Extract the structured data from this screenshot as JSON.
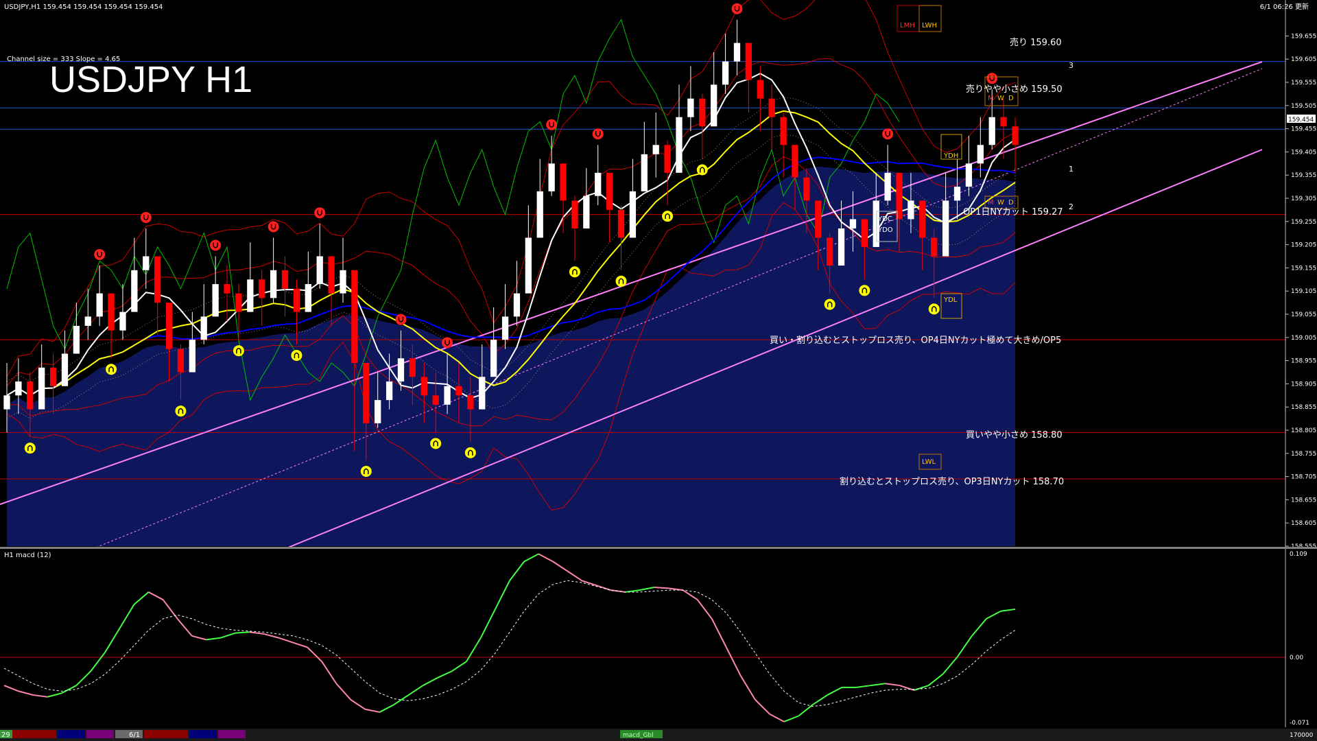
{
  "header": {
    "symbol_info": "USDJPY,H1  159.454 159.454 159.454 159.454",
    "channel_info": "Channel size = 333 Slope = 4.65",
    "big_title": "USDJPY H1",
    "datetime": "6/1 06:26 更新"
  },
  "price_tag": "159.454",
  "channel_labels": [
    "1",
    "2",
    "3"
  ],
  "box_labels": {
    "lmh": "LMH",
    "lwh": "LWH",
    "m": "M",
    "w": "W",
    "d": "D",
    "ydh": "YDH",
    "ydl": "YDL",
    "ydc": "YDC",
    "ydo": "YDO",
    "lwl": "LWL"
  },
  "level_labels": {
    "sell_1": "売り 159.60",
    "sell_2": "売りやや小さめ 159.50",
    "op1": "OP1日NYカット 159.27",
    "buy_1": "買い・割り込むとストップロス売り、OP4日NYカット極めて大きめ/OP5",
    "buy_2": "買いやや小さめ 158.80",
    "buy_3": "割り込むとストップロス売り、OP3日NYカット 158.70"
  },
  "sub_panel": {
    "label": "H1  macd (12)",
    "tab": "macd_Gbl"
  },
  "bottom_bar": {
    "left_date": "29",
    "mid_date": "6/1",
    "volume": "170000"
  },
  "colors": {
    "up": "#ffffff",
    "down": "#ff0000",
    "ma_short": "#ffffff",
    "ma_mid": "#ffff00",
    "ma_long": "#0000ff",
    "kumo_up": "#1a2aa8",
    "kumo_down": "#c8a080",
    "chikou": "#00c000",
    "bollinger": "#cc0000",
    "channel": "#ff80ff",
    "macd_up": "#44ff44",
    "macd_down": "#ff88aa"
  },
  "chart_data": {
    "type": "candlestick",
    "title": "USDJPY H1",
    "ylim": [
      158.555,
      159.7
    ],
    "yticks": [
      159.655,
      159.605,
      159.555,
      159.505,
      159.455,
      159.405,
      159.355,
      159.305,
      159.255,
      159.205,
      159.155,
      159.105,
      159.055,
      159.005,
      158.955,
      158.905,
      158.855,
      158.805,
      158.755,
      158.705,
      158.655,
      158.605,
      158.555
    ],
    "ytick_labels": [
      "159.655",
      "159.605",
      "159.555",
      "159.505",
      "159.455",
      "159.405",
      "159.355",
      "159.305",
      "159.255",
      "159.205",
      "159.155",
      "159.105",
      "159.055",
      "159.005",
      "158.955",
      "158.905",
      "158.855",
      "158.805",
      "158.755",
      "158.705",
      "158.655",
      "158.605",
      "158.555"
    ],
    "last_price": 159.454,
    "levels": [
      159.6,
      159.5,
      159.27,
      159.0,
      158.8,
      158.7
    ],
    "close": [
      158.88,
      158.91,
      158.85,
      158.94,
      158.9,
      158.97,
      159.03,
      159.05,
      159.1,
      159.02,
      159.06,
      159.15,
      159.18,
      159.08,
      158.98,
      158.93,
      159.0,
      159.05,
      159.12,
      159.1,
      159.06,
      159.13,
      159.09,
      159.15,
      159.11,
      159.06,
      159.12,
      159.18,
      159.1,
      159.15,
      158.95,
      158.82,
      158.87,
      158.91,
      158.96,
      158.92,
      158.88,
      158.86,
      158.9,
      158.88,
      158.85,
      158.92,
      159.0,
      159.05,
      159.1,
      159.22,
      159.32,
      159.38,
      159.3,
      159.24,
      159.31,
      159.36,
      159.28,
      159.22,
      159.32,
      159.4,
      159.42,
      159.36,
      159.48,
      159.52,
      159.46,
      159.55,
      159.6,
      159.64,
      159.56,
      159.52,
      159.48,
      159.42,
      159.35,
      159.3,
      159.22,
      159.16,
      159.24,
      159.26,
      159.2,
      159.3,
      159.36,
      159.26,
      159.3,
      159.22,
      159.18,
      159.3,
      159.33,
      159.38,
      159.42,
      159.48,
      159.46,
      159.42
    ],
    "high": [
      158.95,
      158.96,
      158.93,
      158.99,
      158.97,
      159.02,
      159.08,
      159.11,
      159.16,
      159.09,
      159.12,
      159.22,
      159.24,
      159.16,
      159.05,
      158.99,
      159.06,
      159.12,
      159.18,
      159.16,
      159.12,
      159.21,
      159.15,
      159.22,
      159.18,
      159.13,
      159.19,
      159.25,
      159.17,
      159.22,
      159.05,
      158.9,
      158.93,
      158.97,
      159.02,
      158.99,
      158.95,
      158.93,
      158.97,
      158.95,
      158.92,
      158.99,
      159.07,
      159.12,
      159.17,
      159.29,
      159.39,
      159.44,
      159.38,
      159.31,
      159.37,
      159.42,
      159.35,
      159.29,
      159.39,
      159.47,
      159.49,
      159.43,
      159.55,
      159.59,
      159.53,
      159.62,
      159.66,
      159.69,
      159.62,
      159.59,
      159.55,
      159.49,
      159.42,
      159.37,
      159.29,
      159.23,
      159.3,
      159.32,
      159.26,
      159.36,
      159.42,
      159.33,
      159.36,
      159.29,
      159.24,
      159.36,
      159.39,
      159.44,
      159.48,
      159.54,
      159.52,
      159.48
    ],
    "low": [
      158.8,
      158.84,
      158.79,
      158.87,
      158.84,
      158.91,
      158.97,
      159.0,
      159.03,
      158.96,
      159.0,
      159.07,
      159.11,
      159.01,
      158.91,
      158.87,
      158.94,
      158.99,
      159.05,
      159.04,
      159.0,
      159.06,
      159.03,
      159.08,
      159.05,
      158.99,
      159.06,
      159.11,
      159.03,
      159.08,
      158.76,
      158.74,
      158.81,
      158.85,
      158.89,
      158.86,
      158.82,
      158.8,
      158.84,
      158.82,
      158.78,
      158.85,
      158.93,
      158.98,
      159.03,
      159.14,
      159.25,
      159.31,
      159.23,
      159.17,
      159.24,
      159.29,
      159.21,
      159.15,
      159.25,
      159.33,
      159.35,
      159.29,
      159.41,
      159.45,
      159.39,
      159.48,
      159.53,
      159.57,
      159.49,
      159.45,
      159.41,
      159.35,
      159.28,
      159.23,
      159.15,
      159.1,
      159.17,
      159.19,
      159.13,
      159.23,
      159.29,
      159.19,
      159.23,
      159.15,
      159.09,
      159.23,
      159.26,
      159.31,
      159.35,
      159.41,
      159.39,
      159.36
    ],
    "macd": {
      "ylim": [
        -0.071,
        0.109
      ],
      "ytick_labels": [
        "0.109",
        "0.00",
        "-0.071"
      ],
      "values": [
        -0.03,
        -0.036,
        -0.04,
        -0.042,
        -0.038,
        -0.03,
        -0.015,
        0.005,
        0.03,
        0.055,
        0.068,
        0.06,
        0.04,
        0.022,
        0.018,
        0.02,
        0.025,
        0.026,
        0.024,
        0.02,
        0.015,
        0.01,
        -0.005,
        -0.028,
        -0.045,
        -0.055,
        -0.058,
        -0.05,
        -0.04,
        -0.03,
        -0.022,
        -0.015,
        -0.005,
        0.02,
        0.05,
        0.08,
        0.1,
        0.108,
        0.1,
        0.09,
        0.08,
        0.075,
        0.07,
        0.068,
        0.07,
        0.073,
        0.072,
        0.07,
        0.06,
        0.04,
        0.01,
        -0.02,
        -0.045,
        -0.06,
        -0.068,
        -0.062,
        -0.05,
        -0.04,
        -0.032,
        -0.032,
        -0.03,
        -0.028,
        -0.03,
        -0.035,
        -0.03,
        -0.018,
        0.0,
        0.022,
        0.04,
        0.048,
        0.05
      ],
      "signal": [
        -0.012,
        -0.02,
        -0.028,
        -0.034,
        -0.036,
        -0.034,
        -0.028,
        -0.018,
        -0.004,
        0.012,
        0.028,
        0.04,
        0.044,
        0.04,
        0.034,
        0.03,
        0.028,
        0.027,
        0.026,
        0.024,
        0.022,
        0.018,
        0.012,
        0.002,
        -0.012,
        -0.026,
        -0.038,
        -0.044,
        -0.046,
        -0.044,
        -0.04,
        -0.034,
        -0.026,
        -0.014,
        0.004,
        0.026,
        0.048,
        0.066,
        0.076,
        0.08,
        0.078,
        0.074,
        0.07,
        0.068,
        0.068,
        0.069,
        0.07,
        0.07,
        0.068,
        0.06,
        0.046,
        0.026,
        0.004,
        -0.018,
        -0.036,
        -0.048,
        -0.052,
        -0.05,
        -0.046,
        -0.042,
        -0.038,
        -0.035,
        -0.034,
        -0.034,
        -0.033,
        -0.028,
        -0.02,
        -0.008,
        0.006,
        0.018,
        0.028
      ]
    }
  }
}
